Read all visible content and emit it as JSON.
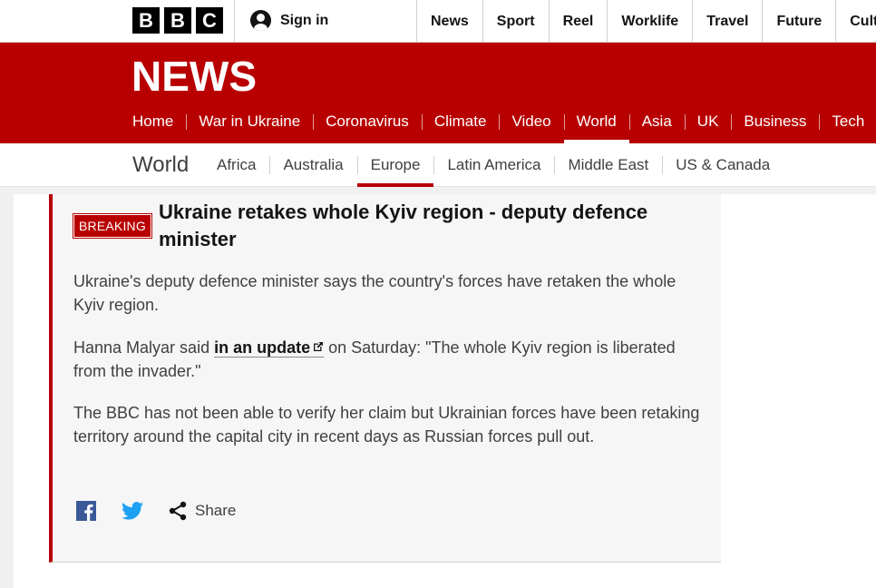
{
  "bbc_logo": {
    "letters": [
      "B",
      "B",
      "C"
    ]
  },
  "account": {
    "signin_label": "Sign in",
    "icon": "user-icon"
  },
  "top_nav": [
    "News",
    "Sport",
    "Reel",
    "Worklife",
    "Travel",
    "Future",
    "Culture"
  ],
  "news_banner": {
    "logo": "NEWS",
    "items": [
      "Home",
      "War in Ukraine",
      "Coronavirus",
      "Climate",
      "Video",
      "World",
      "Asia",
      "UK",
      "Business",
      "Tech"
    ],
    "active": "World"
  },
  "sub_nav": {
    "title": "World",
    "items": [
      "Africa",
      "Australia",
      "Europe",
      "Latin America",
      "Middle East",
      "US & Canada"
    ],
    "active": "Europe"
  },
  "article": {
    "badge": "BREAKING",
    "headline": "Ukraine retakes whole Kyiv region - deputy defence minister",
    "para1": "Ukraine's deputy defence minister says the country's forces have retaken the whole Kyiv region.",
    "para2_before": "Hanna Malyar said ",
    "para2_link": "in an update",
    "para2_after": " on Saturday: \"The whole Kyiv region is liberated from the invader.\"",
    "para3": "The BBC has not been able to verify her claim but Ukrainian forces have been retaking territory around the capital city in recent days as Russian forces pull out."
  },
  "share": {
    "label": "Share",
    "icons": [
      "facebook-icon",
      "twitter-icon",
      "share-icon"
    ]
  },
  "colors": {
    "bbc_red": "#b80000",
    "card_bg": "#f6f6f6",
    "text_dark": "#141414",
    "facebook": "#3b5998",
    "twitter": "#1da1f2"
  }
}
